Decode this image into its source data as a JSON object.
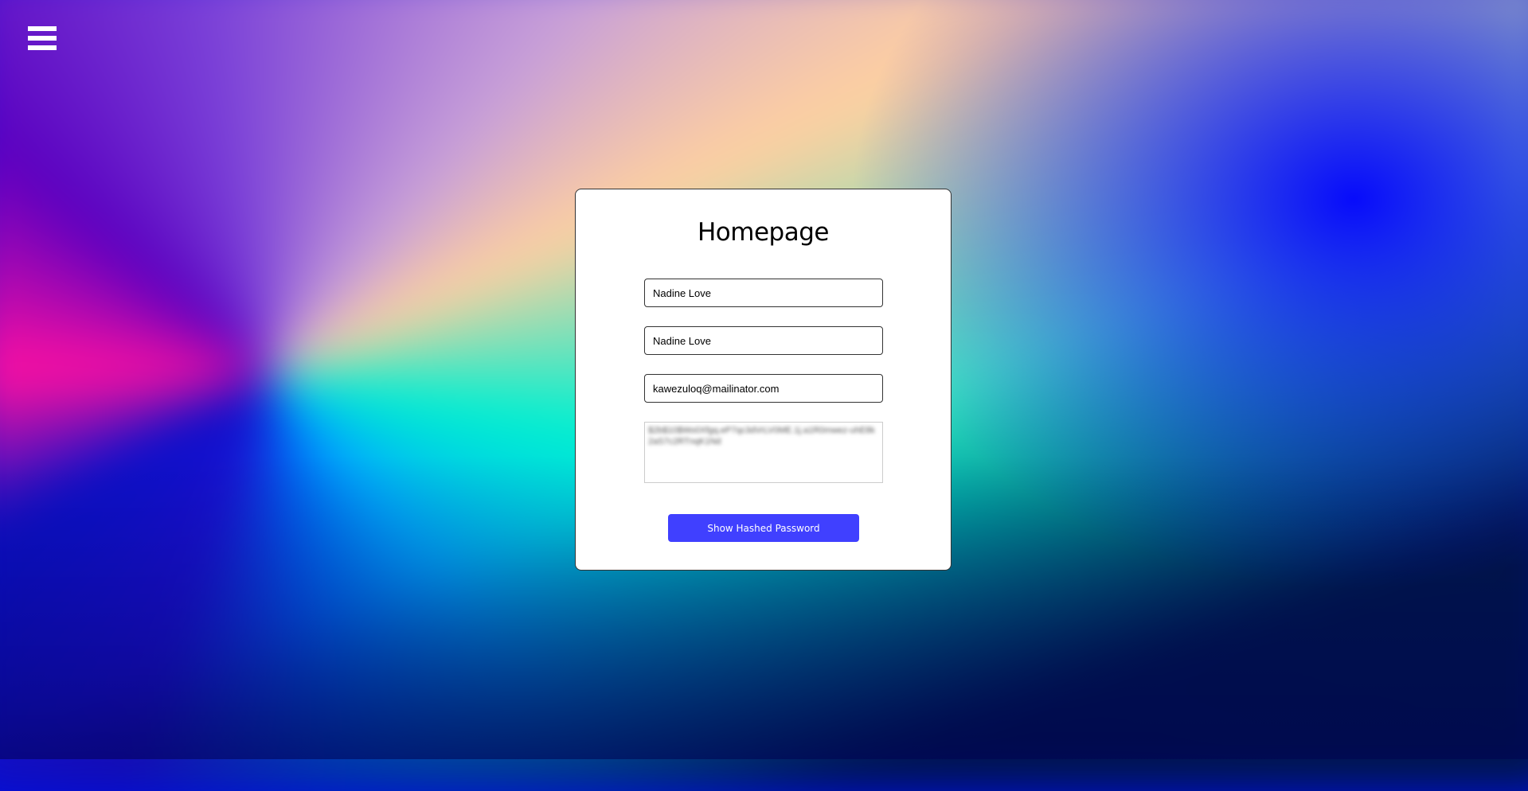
{
  "menu": {
    "icon": "hamburger-menu-icon"
  },
  "card": {
    "title": "Homepage",
    "first_name": "Nadine Love",
    "last_name": "Nadine Love",
    "email": "kawezuloq@mailinator.com",
    "hashed_password_blurred": "$2b$10$Wo0Xfgq.eP7qc3dVrLV0ME.1j.a1R0mwez-uhE8k2aS7c2RTnqK1Nd",
    "button_label": "Show Hashed Password"
  },
  "colors": {
    "accent": "#4040ff"
  }
}
